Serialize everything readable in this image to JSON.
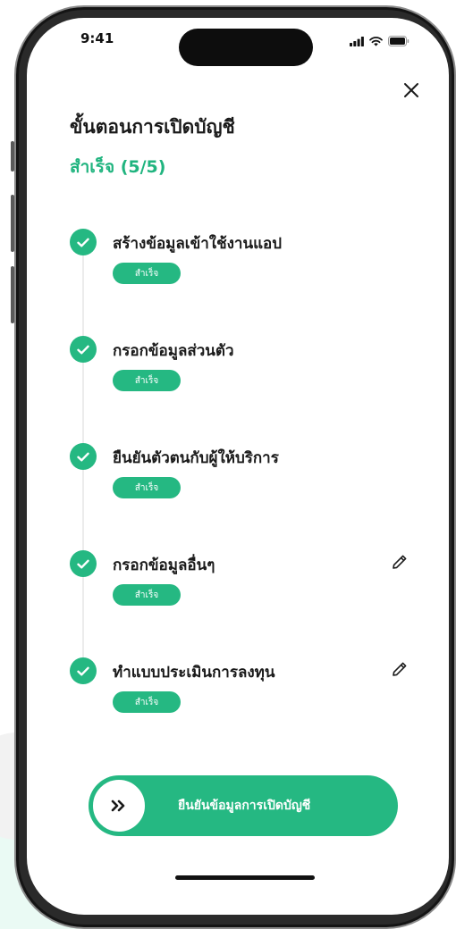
{
  "status_bar": {
    "time": "9:41",
    "icons": [
      "signal-icon",
      "wifi-icon",
      "battery-icon"
    ]
  },
  "header": {
    "close_icon": "close-icon",
    "title": "ขั้นตอนการเปิดบัญชี",
    "progress": "สำเร็จ (5/5)"
  },
  "steps": [
    {
      "label": "สร้างข้อมูลเข้าใช้งานแอป",
      "status": "สำเร็จ",
      "editable": false
    },
    {
      "label": "กรอกข้อมูลส่วนตัว",
      "status": "สำเร็จ",
      "editable": false
    },
    {
      "label": "ยืนยันตัวตนกับผู้ให้บริการ",
      "status": "สำเร็จ",
      "editable": false
    },
    {
      "label": "กรอกข้อมูลอื่นๆ",
      "status": "สำเร็จ",
      "editable": true
    },
    {
      "label": "ทำแบบประเมินการลงทุน",
      "status": "สำเร็จ",
      "editable": true
    }
  ],
  "confirm": {
    "label": "ยืนยันข้อมูลการเปิดบัญชี",
    "knob_icon": "double-chevron-right-icon"
  },
  "colors": {
    "accent": "#25b882",
    "title_text": "#1a1a1a",
    "progress_text": "#20b47f",
    "frame": "#2a2a2a"
  }
}
